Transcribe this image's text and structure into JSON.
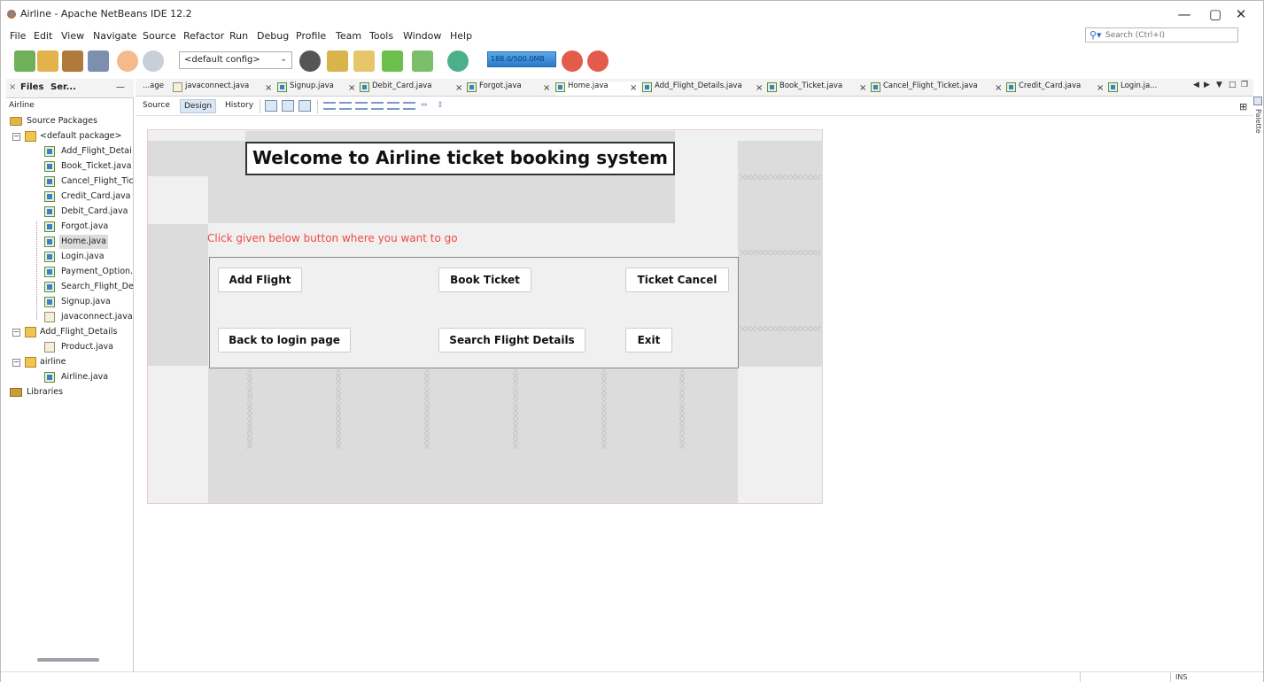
{
  "window": {
    "title": "Airline - Apache NetBeans IDE 12.2",
    "controls": {
      "minimize": "—",
      "maximize": "▢",
      "close": "✕"
    }
  },
  "menu": [
    "File",
    "Edit",
    "View",
    "Navigate",
    "Source",
    "Refactor",
    "Run",
    "Debug",
    "Profile",
    "Team",
    "Tools",
    "Window",
    "Help"
  ],
  "ide_search": {
    "placeholder": "Search (Ctrl+I)"
  },
  "toolbar": {
    "config": "<default config>",
    "memory_label": "188.0/500.0MB"
  },
  "left_panel": {
    "tabs": [
      "Files",
      "Ser..."
    ],
    "project": "Airline",
    "tree": [
      {
        "label": "Source Packages",
        "type": "folder",
        "level": 0
      },
      {
        "label": "<default package>",
        "type": "package",
        "level": 1,
        "expanded": true
      },
      {
        "label": "Add_Flight_Detai",
        "type": "form",
        "level": 2
      },
      {
        "label": "Book_Ticket.java",
        "type": "form",
        "level": 2
      },
      {
        "label": "Cancel_Flight_Tic",
        "type": "form",
        "level": 2
      },
      {
        "label": "Credit_Card.java",
        "type": "form",
        "level": 2
      },
      {
        "label": "Debit_Card.java",
        "type": "form",
        "level": 2
      },
      {
        "label": "Forgot.java",
        "type": "form",
        "level": 2
      },
      {
        "label": "Home.java",
        "type": "form",
        "level": 2,
        "selected": true
      },
      {
        "label": "Login.java",
        "type": "form",
        "level": 2
      },
      {
        "label": "Payment_Option.",
        "type": "form",
        "level": 2
      },
      {
        "label": "Search_Flight_De",
        "type": "form",
        "level": 2
      },
      {
        "label": "Signup.java",
        "type": "form",
        "level": 2
      },
      {
        "label": "javaconnect.java",
        "type": "java",
        "level": 2
      },
      {
        "label": "Add_Flight_Details",
        "type": "package",
        "level": 1,
        "expanded": true
      },
      {
        "label": "Product.java",
        "type": "java",
        "level": 2
      },
      {
        "label": "airline",
        "type": "package",
        "level": 1,
        "expanded": true
      },
      {
        "label": "Airline.java",
        "type": "form",
        "level": 2
      },
      {
        "label": "Libraries",
        "type": "library",
        "level": 0
      }
    ]
  },
  "editor_tabs": [
    {
      "label": "...age",
      "icon": "none"
    },
    {
      "label": "javaconnect.java",
      "icon": "java"
    },
    {
      "label": "Signup.java",
      "icon": "form"
    },
    {
      "label": "Debit_Card.java",
      "icon": "form"
    },
    {
      "label": "Forgot.java",
      "icon": "form"
    },
    {
      "label": "Home.java",
      "icon": "form",
      "active": true
    },
    {
      "label": "Add_Flight_Details.java",
      "icon": "form"
    },
    {
      "label": "Book_Ticket.java",
      "icon": "form"
    },
    {
      "label": "Cancel_Flight_Ticket.java",
      "icon": "form"
    },
    {
      "label": "Credit_Card.java",
      "icon": "form"
    },
    {
      "label": "Login.ja...",
      "icon": "form"
    }
  ],
  "designer": {
    "views": [
      "Source",
      "Design",
      "History"
    ],
    "active_view": "Design",
    "palette_label": "Palette"
  },
  "form": {
    "heading": "Welcome to Airline ticket booking system",
    "prompt": "Click given below button where you want to go",
    "buttons": {
      "add_flight": "Add Flight",
      "book_ticket": "Book Ticket",
      "ticket_cancel": "Ticket Cancel",
      "back_to_login": "Back to login page",
      "search_flight": "Search Flight Details",
      "exit": "Exit"
    }
  },
  "status": {
    "ins": "INS"
  },
  "colors": {
    "prompt": "#f04848",
    "active_view": "#dbe6f3",
    "memory_bar": "#2a78c9"
  }
}
